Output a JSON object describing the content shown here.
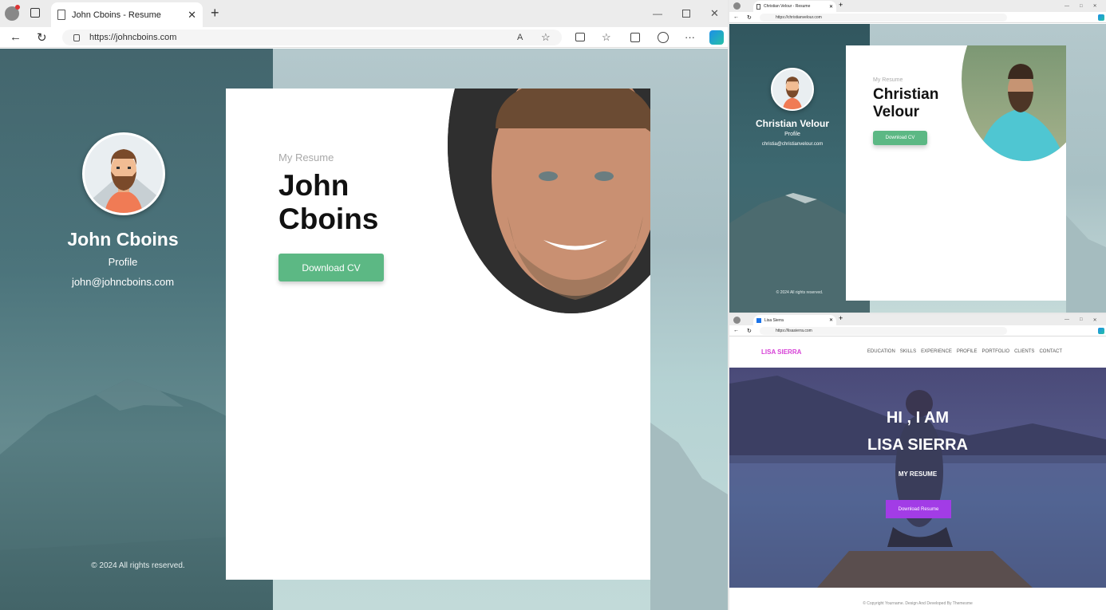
{
  "main": {
    "tab_title": "John Cboins - Resume",
    "url": "https://johncboins.com",
    "sidebar": {
      "name": "John Cboins",
      "profile_label": "Profile",
      "email": "john@johncboins.com",
      "copyright": "© 2024 All rights reserved."
    },
    "hero": {
      "subtitle": "My Resume",
      "first_name": "John",
      "last_name": "Cboins",
      "button": "Download CV"
    }
  },
  "top_right": {
    "tab_title": "Christian Velour - Resume",
    "url": "https://christianvelour.com",
    "sidebar": {
      "name": "Christian Velour",
      "profile_label": "Profile",
      "email": "christia@christianvelour.com",
      "copyright": "© 2024 All rights reserved."
    },
    "hero": {
      "subtitle": "My Resume",
      "first_name": "Christian",
      "last_name": "Velour",
      "button": "Download CV"
    }
  },
  "bottom_right": {
    "tab_title": "Lisa Sierra",
    "url": "https://lisasierra.com",
    "brand": "LISA SIERRA",
    "nav": [
      "EDUCATION",
      "SKILLS",
      "EXPERIENCE",
      "PROFILE",
      "PORTFOLIO",
      "CLIENTS",
      "CONTACT"
    ],
    "hero": {
      "line1": "HI , I AM",
      "line2": "LISA SIERRA",
      "subtitle": "MY RESUME",
      "button": "Download Resume"
    },
    "footer": "© Copyright Yourname. Design And Developed By Themesme"
  },
  "colors": {
    "accent_green": "#5cb884",
    "accent_purple": "#a23ce6",
    "brand_pink": "#d63fd6"
  }
}
